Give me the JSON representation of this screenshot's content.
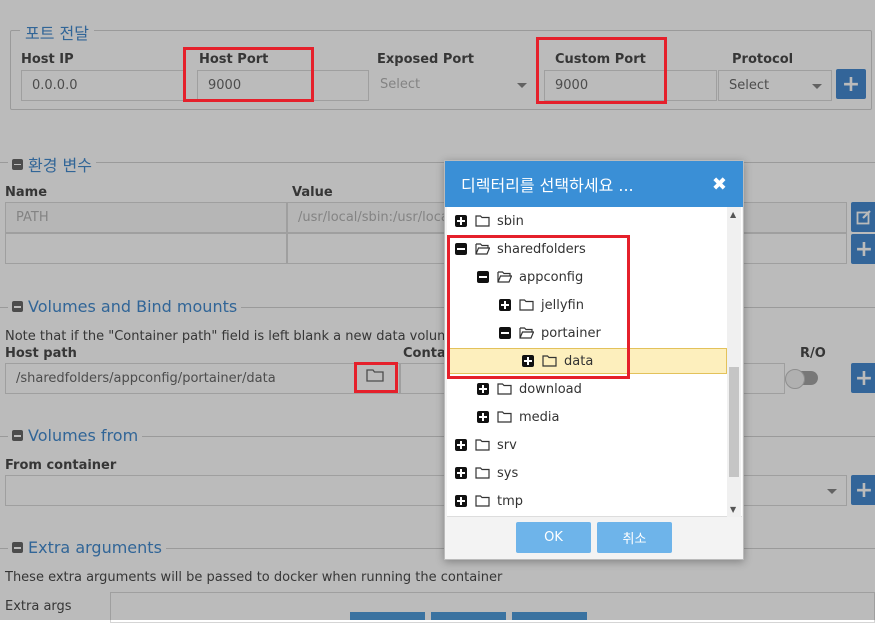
{
  "port_section": {
    "legend": "포트 전달",
    "host_ip_label": "Host IP",
    "host_ip_value": "0.0.0.0",
    "host_port_label": "Host Port",
    "host_port_value": "9000",
    "exposed_port_label": "Exposed Port",
    "exposed_port_placeholder": "Select",
    "custom_port_label": "Custom Port",
    "custom_port_value": "9000",
    "protocol_label": "Protocol",
    "protocol_value": "Select",
    "add_symbol": "+"
  },
  "env_section": {
    "legend": "환경 변수",
    "name_label": "Name",
    "value_label": "Value",
    "row_name": "PATH",
    "row_value": "/usr/local/sbin:/usr/local"
  },
  "volumes_section": {
    "legend": "Volumes and Bind mounts",
    "note": "Note that if the \"Container path\" field is left blank a new data volume will",
    "host_path_label": "Host path",
    "container_label": "Contai",
    "host_path_value": "/sharedfolders/appconfig/portainer/data",
    "ro_label": "R/O"
  },
  "volumes_from_section": {
    "legend": "Volumes from",
    "from_container_label": "From container"
  },
  "extra_section": {
    "legend": "Extra arguments",
    "note": "These extra arguments will be passed to docker when running the container",
    "extra_args_label": "Extra args"
  },
  "dialog": {
    "title": "디렉터리를 선택하세요 ...",
    "close_symbol": "✖",
    "ok_label": "OK",
    "cancel_label": "취소",
    "tree": [
      {
        "label": "sbin",
        "expanded": false
      },
      {
        "label": "sharedfolders",
        "expanded": true
      },
      {
        "label": "appconfig",
        "expanded": true
      },
      {
        "label": "jellyfin",
        "expanded": false
      },
      {
        "label": "portainer",
        "expanded": true
      },
      {
        "label": "data",
        "expanded": false,
        "selected": true
      },
      {
        "label": "download",
        "expanded": false
      },
      {
        "label": "media",
        "expanded": false
      },
      {
        "label": "srv",
        "expanded": false
      },
      {
        "label": "sys",
        "expanded": false
      },
      {
        "label": "tmp",
        "expanded": false
      }
    ]
  },
  "colors": {
    "accent": "#2f7ccb",
    "highlight_box": "#e5202b",
    "dialog_header": "#3a8fd6",
    "selected_row": "#fdefbd"
  }
}
